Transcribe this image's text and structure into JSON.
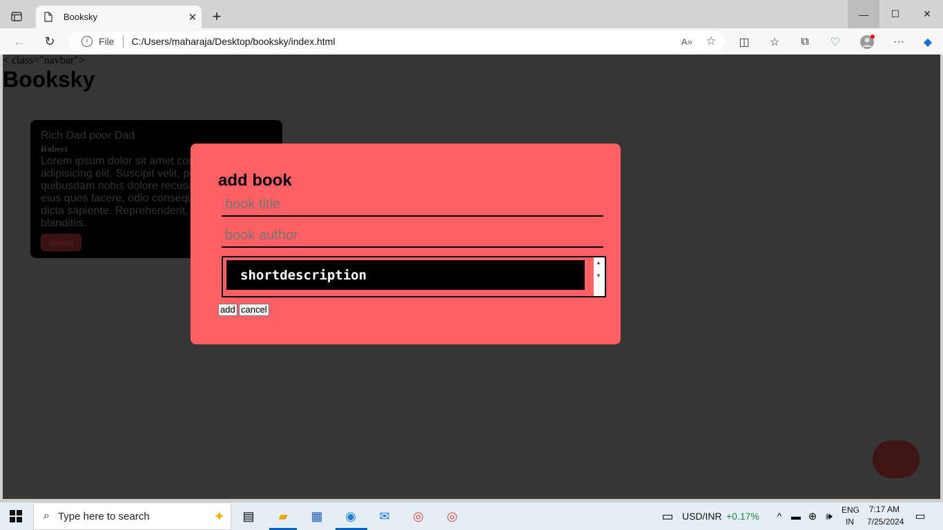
{
  "browser": {
    "tab_title": "Booksky",
    "file_label": "File",
    "url": "C:/Users/maharaja/Desktop/booksky/index.html"
  },
  "page": {
    "navbar_fragment": "< class=\"navbar\">",
    "brand": "Booksky",
    "card": {
      "title": "Rich Dad poor Dad",
      "author": "Robert",
      "description": "Lorem ipsum dolor sit amet consectetur adipisicing elit. Suscipit velit, perferendis quibusdam nobis dolore recusandae inventore eius quos facere, odio consequuntur modi dicta sapiente. Reprehenderit, earum. Ex, blanditiis.",
      "delete_label": "delete"
    },
    "fab_label": "+",
    "modal": {
      "heading": "add book",
      "title_placeholder": "book title",
      "author_placeholder": "book author",
      "description_placeholder": "shortdescription",
      "add_label": "add",
      "cancel_label": "cancel"
    }
  },
  "taskbar": {
    "search_placeholder": "Type here to search",
    "ticker_label": "USD/INR",
    "ticker_change": "+0.17%",
    "lang_top": "ENG",
    "lang_bottom": "IN",
    "time": "7:17 AM",
    "date": "7/25/2024"
  },
  "colors": {
    "modal_bg": "#fd6064",
    "page_bg": "#363636",
    "ticker_positive": "#1a8a3a"
  }
}
